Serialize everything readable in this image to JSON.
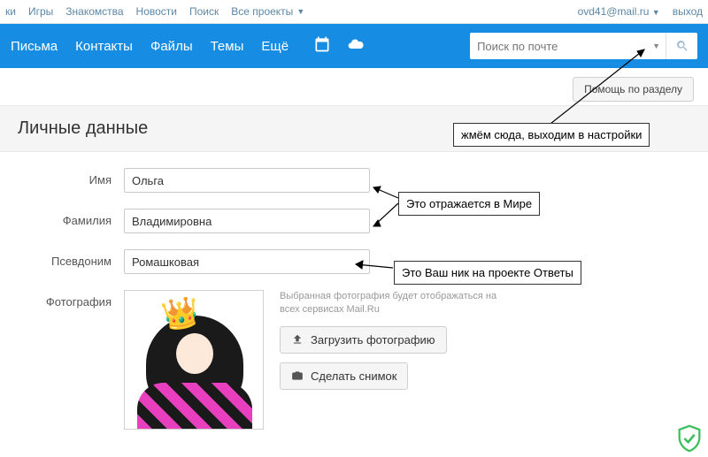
{
  "topnav": {
    "items": [
      "ки",
      "Игры",
      "Знакомства",
      "Новости",
      "Поиск"
    ],
    "all_projects": "Все проекты",
    "email": "ovd41@mail.ru",
    "logout": "выход"
  },
  "mainnav": {
    "items": [
      "Письма",
      "Контакты",
      "Файлы",
      "Темы",
      "Ещё"
    ]
  },
  "search": {
    "placeholder": "Поиск по почте"
  },
  "help_button": "Помощь по разделу",
  "section_title": "Личные данные",
  "form": {
    "name_label": "Имя",
    "name_value": "Ольга",
    "surname_label": "Фамилия",
    "surname_value": "Владимировна",
    "nick_label": "Псевдоним",
    "nick_value": "Ромашковая",
    "photo_label": "Фотография",
    "photo_hint": "Выбранная фотография будет отображаться на всех сервисах Mail.Ru",
    "upload_btn": "Загрузить фотографию",
    "snapshot_btn": "Сделать снимок"
  },
  "annotations": {
    "settings": "жмём сюда, выходим в настройки",
    "mir": "Это отражается в Мире",
    "nick": "Это Ваш ник на проекте Ответы"
  }
}
